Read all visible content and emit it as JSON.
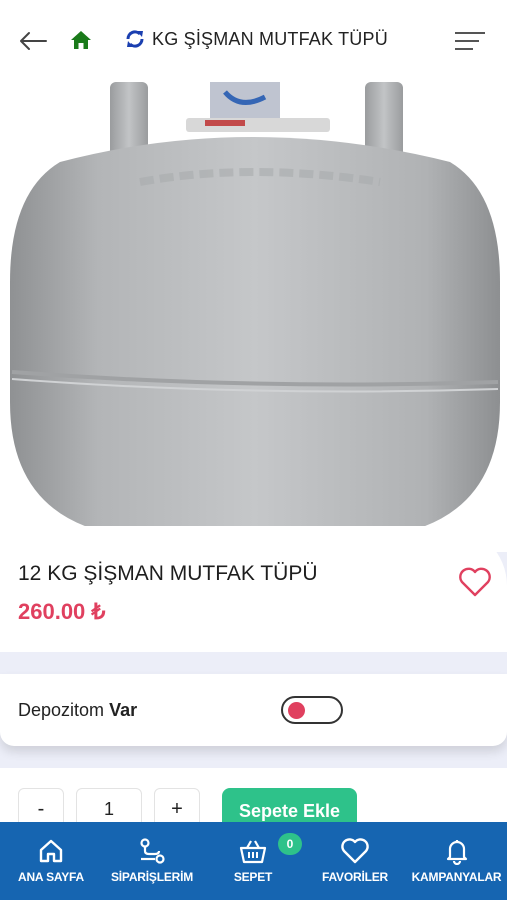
{
  "header": {
    "title": "KG ŞİŞMAN MUTFAK TÜPÜ",
    "icons": {
      "back": "arrow-left-icon",
      "home": "home-icon",
      "title": "refresh-icon",
      "menu": "menu-icon"
    },
    "home_color": "#1a7a1a",
    "title_icon_color": "#1a3fb0"
  },
  "product": {
    "name": "12 KG ŞİŞMAN MUTFAK TÜPÜ",
    "price": "260.00 ₺",
    "price_color": "#e0405f",
    "favorite_icon": "heart-icon"
  },
  "deposit": {
    "label": "Depozitom",
    "value": "Var",
    "toggle_on": false
  },
  "quantity": {
    "minus": "-",
    "value": "1",
    "plus": "+"
  },
  "add_to_cart": {
    "label": "Sepete Ekle",
    "color": "#2ec28a"
  },
  "bottom_nav": {
    "background": "#1665b1",
    "items": [
      {
        "label": "ANA SAYFA",
        "icon": "home-icon"
      },
      {
        "label": "SİPARİŞLERİM",
        "icon": "route-icon"
      },
      {
        "label": "SEPET",
        "icon": "basket-icon"
      },
      {
        "label": "FAVORİLER",
        "icon": "heart-icon"
      },
      {
        "label": "KAMPANYALAR",
        "icon": "bell-icon"
      }
    ],
    "cart_count": "0"
  }
}
